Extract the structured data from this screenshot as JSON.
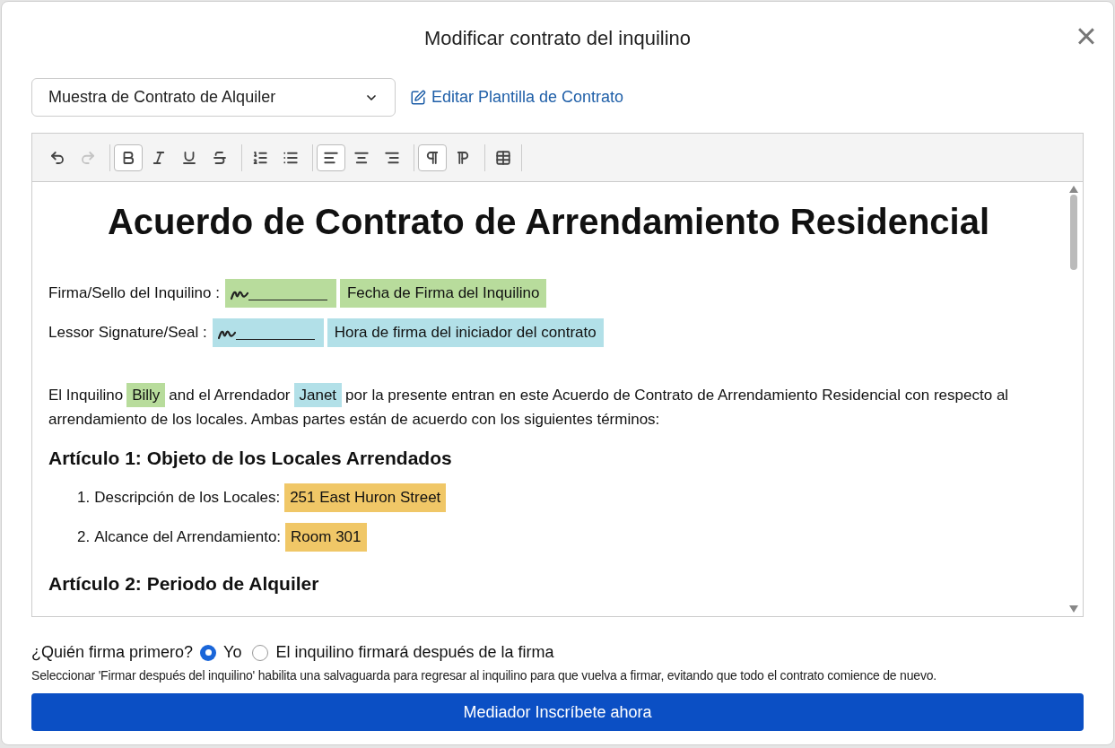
{
  "dialog": {
    "title": "Modificar contrato del inquilino",
    "close": "×"
  },
  "template_select": {
    "value": "Muestra de Contrato de Alquiler"
  },
  "edit_template_link": "Editar Plantilla de Contrato",
  "toolbar": [
    [
      {
        "kind": "undo",
        "active": false,
        "disabled": false
      },
      {
        "kind": "redo",
        "active": false,
        "disabled": true
      }
    ],
    [
      {
        "kind": "bold",
        "active": true,
        "disabled": false
      },
      {
        "kind": "italic",
        "active": false,
        "disabled": false
      },
      {
        "kind": "underline",
        "active": false,
        "disabled": false
      },
      {
        "kind": "strike",
        "active": false,
        "disabled": false
      }
    ],
    [
      {
        "kind": "ordered",
        "active": false,
        "disabled": false
      },
      {
        "kind": "bullets",
        "active": false,
        "disabled": false
      }
    ],
    [
      {
        "kind": "align-left",
        "active": true,
        "disabled": false
      },
      {
        "kind": "align-center",
        "active": false,
        "disabled": false
      },
      {
        "kind": "align-right",
        "active": false,
        "disabled": false
      }
    ],
    [
      {
        "kind": "ltr",
        "active": true,
        "disabled": false
      },
      {
        "kind": "rtl",
        "active": false,
        "disabled": false
      }
    ],
    [
      {
        "kind": "table",
        "active": false,
        "disabled": false
      }
    ]
  ],
  "document": {
    "title": "Acuerdo de Contrato de Arrendamiento Residencial",
    "signature_rows": [
      {
        "label": "Firma/Sello del Inquilino :",
        "field": "Fecha de Firma del Inquilino",
        "color": "#b8dc9c"
      },
      {
        "label": "Lessor Signature/Seal :",
        "field": "Hora de firma del iniciador del contrato",
        "color": "#b2e0e8"
      }
    ],
    "paragraph": [
      {
        "kind": "text",
        "text": "El Inquilino"
      },
      {
        "kind": "tag",
        "text": "Billy",
        "color": "#b8dc9c"
      },
      {
        "kind": "text",
        "text": "and el Arrendador"
      },
      {
        "kind": "tag",
        "text": "Janet",
        "color": "#b2e0e8"
      },
      {
        "kind": "text",
        "text": "por la presente entran en este Acuerdo de Contrato de Arrendamiento Residencial con respecto al arrendamiento de los locales. Ambas partes están de acuerdo con los siguientes términos:"
      }
    ],
    "sections": [
      {
        "heading": "Artículo 1: Objeto de los Locales Arrendados",
        "items": [
          {
            "number": "1.",
            "label": "Descripción de los Locales:",
            "value": "251 East Huron Street",
            "color": "#f0c767"
          },
          {
            "number": "2.",
            "label": "Alcance del Arrendamiento:",
            "value": "Room 301",
            "color": "#f0c767"
          }
        ]
      },
      {
        "heading": "Artículo 2: Periodo de Alquiler"
      }
    ]
  },
  "signing_order": {
    "question": "¿Quién firma primero?",
    "options": [
      {
        "label": "Yo",
        "selected": true
      },
      {
        "label": "El inquilino firmará después de la firma",
        "selected": false
      }
    ],
    "note": "Seleccionar 'Firmar después del inquilino' habilita una salvaguarda para regresar al inquilino para que vuelva a firmar, evitando que todo el contrato comience de nuevo."
  },
  "submit_button": "Mediador Inscríbete ahora"
}
